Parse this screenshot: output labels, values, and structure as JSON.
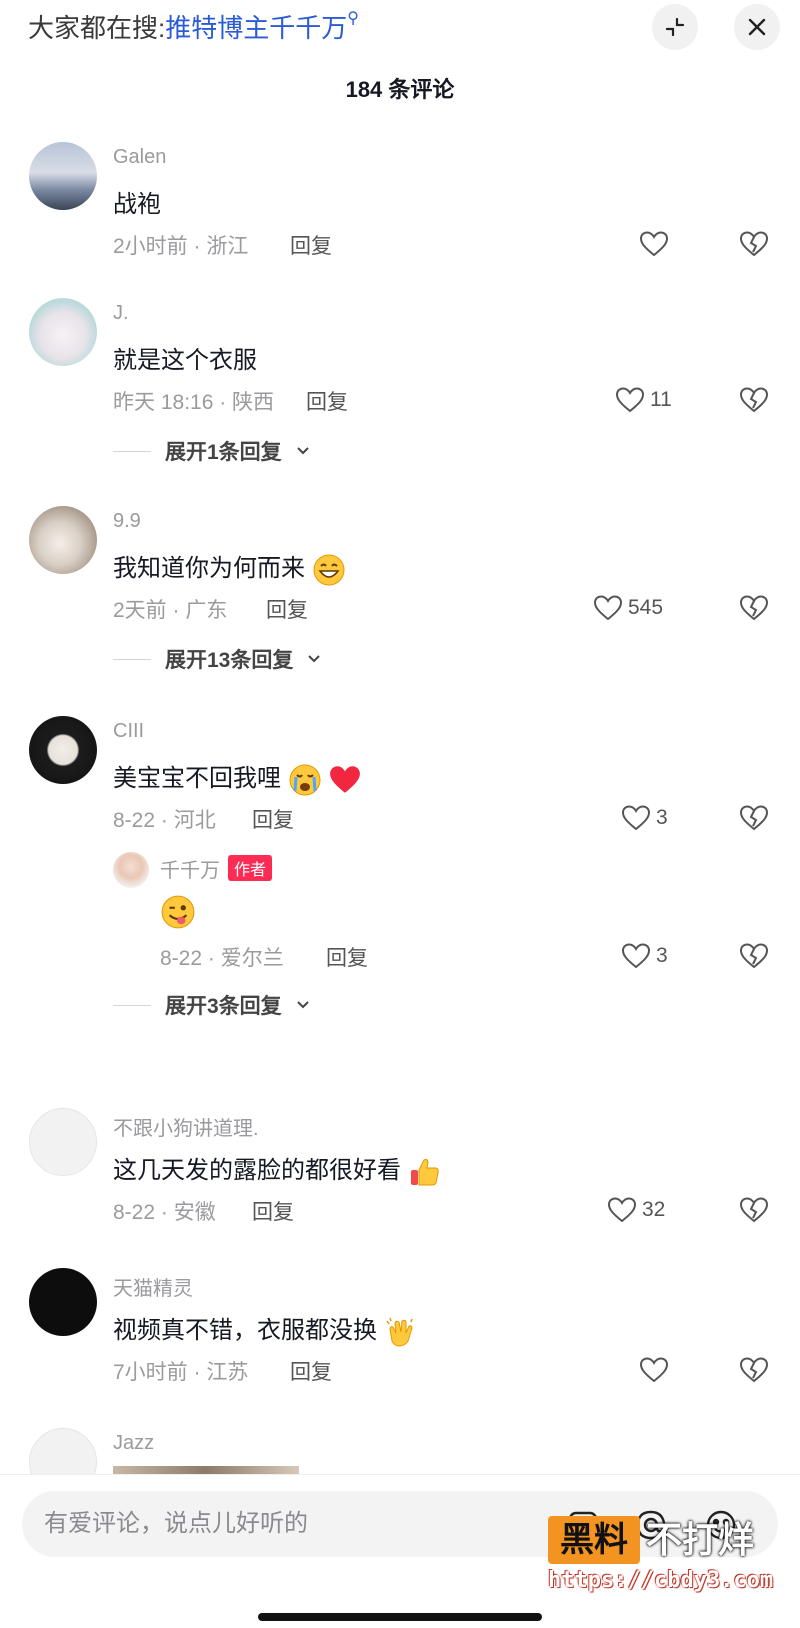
{
  "header": {
    "search_prefix": "大家都在搜:",
    "search_keyword": "推特博主千千万",
    "comment_count": "184 条评论"
  },
  "comments": [
    {
      "user": "Galen",
      "text": "战袍",
      "time_location": "2小时前 · 浙江",
      "reply_label": "回复",
      "likes": ""
    },
    {
      "user": "J.",
      "text": "就是这个衣服",
      "time_location": "昨天 18:16 · 陕西",
      "reply_label": "回复",
      "likes": "11",
      "expand": "展开1条回复"
    },
    {
      "user": "9.9",
      "text": "我知道你为何而来",
      "time_location": "2天前 · 广东",
      "reply_label": "回复",
      "likes": "545",
      "expand": "展开13条回复"
    },
    {
      "user": "CIII",
      "text": "美宝宝不回我哩",
      "time_location": "8-22 · 河北",
      "reply_label": "回复",
      "likes": "3",
      "expand": "展开3条回复",
      "reply": {
        "user": "千千万",
        "badge": "作者",
        "text": "",
        "time_location": "8-22 · 爱尔兰",
        "reply_label": "回复",
        "likes": "3"
      }
    },
    {
      "user": "不跟小狗讲道理.",
      "text": "这几天发的露脸的都很好看",
      "time_location": "8-22 · 安徽",
      "reply_label": "回复",
      "likes": "32"
    },
    {
      "user": "天猫精灵",
      "text": "视频真不错，衣服都没换",
      "time_location": "7小时前 · 江苏",
      "reply_label": "回复",
      "likes": ""
    },
    {
      "user": "Jazz"
    }
  ],
  "input": {
    "placeholder": "有爱评论，说点儿好听的"
  },
  "icons": {
    "collapse": "collapse-icon",
    "close": "close-icon",
    "like": "heart-icon",
    "dislike": "broken-heart-icon",
    "image": "image-icon",
    "mention": "at-icon",
    "emoji": "emoji-icon"
  },
  "watermark": {
    "badge": "黑料",
    "text": "不打烊",
    "url": "https://cbdy3.com"
  },
  "colors": {
    "accent_link": "#2a5bd7",
    "author_badge": "#fe2c55",
    "watermark_orange": "#f29322"
  }
}
